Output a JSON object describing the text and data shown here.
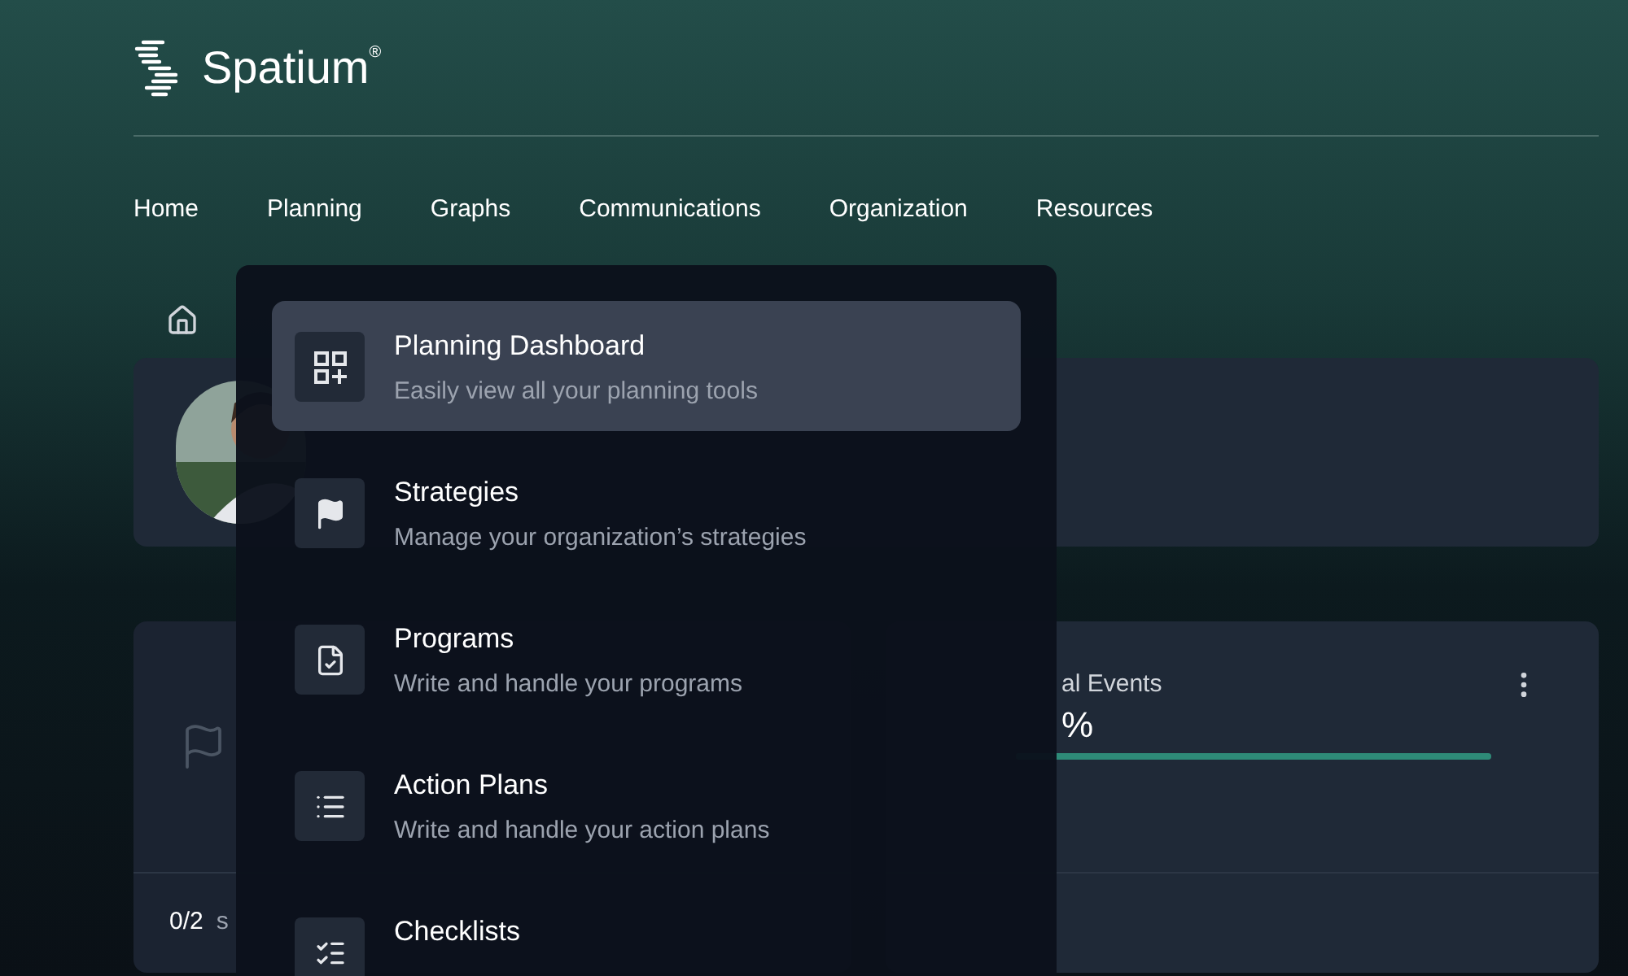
{
  "brand": {
    "name": "Spatium",
    "mark": "®"
  },
  "nav": [
    {
      "label": "Home"
    },
    {
      "label": "Planning"
    },
    {
      "label": "Graphs"
    },
    {
      "label": "Communications"
    },
    {
      "label": "Organization"
    },
    {
      "label": "Resources"
    }
  ],
  "cards": [
    {
      "footer_count": "0/2",
      "footer_text": "s"
    },
    {
      "title_fragment": "al Events",
      "value_fragment": "%",
      "level": 1
    }
  ],
  "menu": [
    {
      "kind": "dashboard",
      "title": "Planning Dashboard",
      "description": "Easily view all your planning tools",
      "selected": true
    },
    {
      "kind": "flag",
      "title": "Strategies",
      "description": "Manage your organization’s strategies",
      "selected": false
    },
    {
      "kind": "document",
      "title": "Programs",
      "description": "Write and handle your programs",
      "selected": false
    },
    {
      "kind": "list",
      "title": "Action Plans",
      "description": "Write and handle your action plans",
      "selected": false
    },
    {
      "kind": "checklist",
      "title": "Checklists",
      "selected": false
    }
  ]
}
